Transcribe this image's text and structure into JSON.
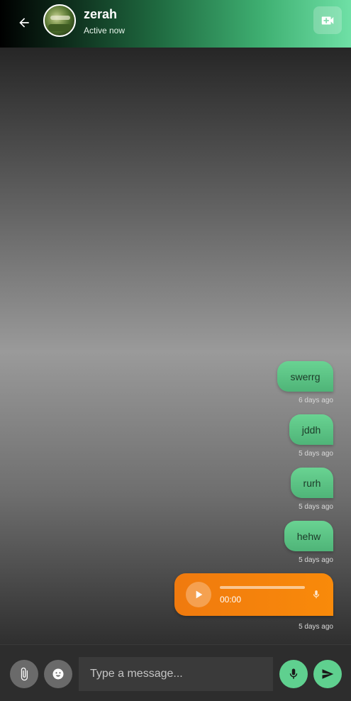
{
  "header": {
    "contact_name": "zerah",
    "contact_status": "Active now"
  },
  "messages": [
    {
      "type": "text",
      "text": "swerrg",
      "time": "6 days ago"
    },
    {
      "type": "text",
      "text": "jddh",
      "time": "5 days ago"
    },
    {
      "type": "text",
      "text": "rurh",
      "time": "5 days ago"
    },
    {
      "type": "text",
      "text": "hehw",
      "time": "5 days ago"
    },
    {
      "type": "voice",
      "duration": "00:00",
      "progress": 0,
      "time": "5 days ago"
    }
  ],
  "composer": {
    "placeholder": "Type a message..."
  },
  "colors": {
    "accent": "#5fd08f",
    "bubble": "#5cc486",
    "voice_bubble": "#f98a0a"
  },
  "icons": [
    "back-arrow-icon",
    "video-call-icon",
    "play-icon",
    "mic-icon",
    "paperclip-icon",
    "emoji-icon",
    "send-icon"
  ]
}
